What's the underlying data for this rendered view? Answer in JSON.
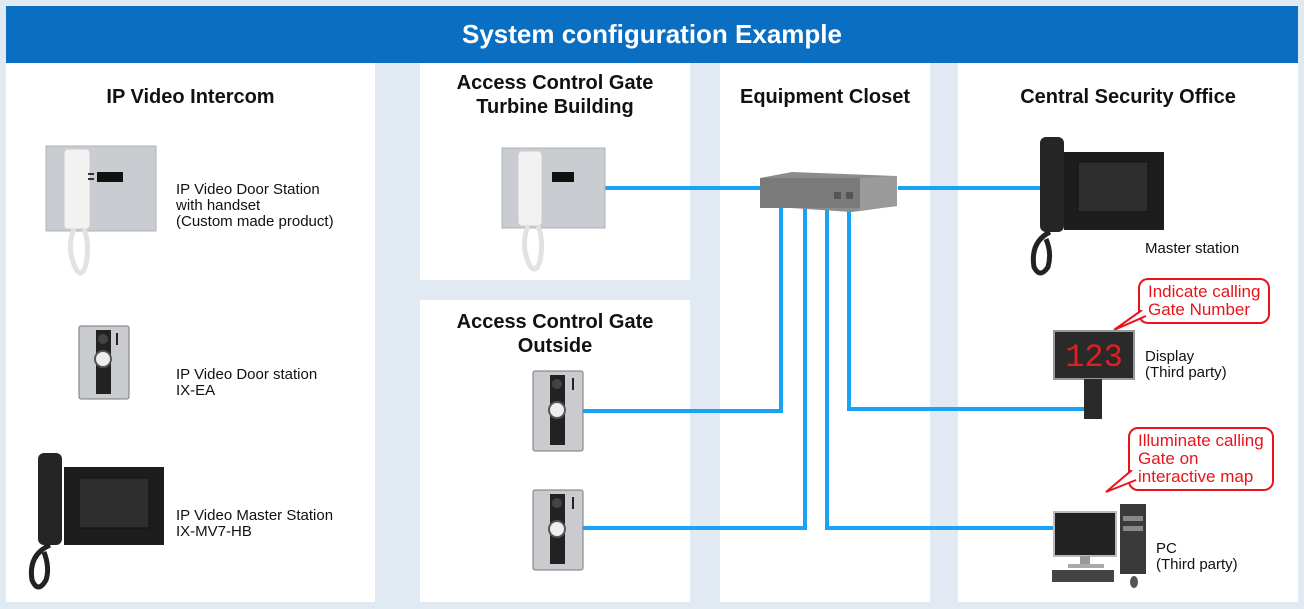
{
  "title": "System configuration Example",
  "colors": {
    "header_bg": "#0a6fc2",
    "wire": "#1aa3f5",
    "callout": "#e8141b",
    "page_bg": "#e1e9f3"
  },
  "columns": {
    "ip_video_intercom": {
      "heading": "IP Video Intercom",
      "devices": [
        {
          "icon": "door-station-handset-icon",
          "label": "IP Video Door Station\nwith handset\n(Custom made product)"
        },
        {
          "icon": "door-station-icon",
          "label": "IP Video Door station\nIX-EA"
        },
        {
          "icon": "master-station-icon",
          "label": "IP Video Master Station\nIX-MV7-HB"
        }
      ]
    },
    "turbine_building": {
      "heading": "Access Control Gate\nTurbine Building"
    },
    "outside": {
      "heading": "Access Control Gate\nOutside"
    },
    "equipment_closet": {
      "heading": "Equipment Closet",
      "device_icon": "network-switch-icon"
    },
    "central_security_office": {
      "heading": "Central Security Office",
      "master_label": "Master station",
      "display_label": "Display\n(Third party)",
      "display_digits": "123",
      "pc_label": "PC\n(Third party)",
      "callouts": [
        "Indicate calling\nGate Number",
        "Illuminate calling\nGate on\ninteractive map"
      ]
    }
  }
}
